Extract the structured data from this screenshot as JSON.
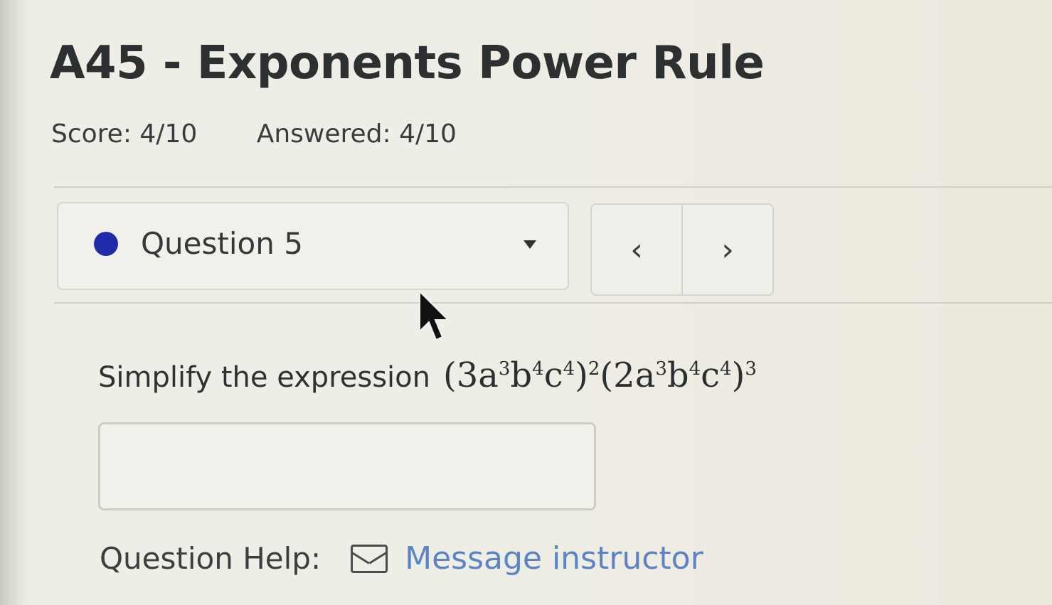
{
  "assignment": {
    "title": "A45 - Exponents Power Rule",
    "score": "Score: 4/10",
    "answered": "Answered: 4/10"
  },
  "question_nav": {
    "selected": "Question 5",
    "prev_label": "‹",
    "next_label": "›"
  },
  "question": {
    "prompt": "Simplify the expression",
    "expr": {
      "open1": "(3a",
      "a_exp1": "3",
      "b1": "b",
      "b_exp1": "4",
      "c1": "c",
      "c_exp1": "4",
      "close1": ")",
      "outer_exp1": "2",
      "open2": "(2a",
      "a_exp2": "3",
      "b2": "b",
      "b_exp2": "4",
      "c2": "c",
      "c_exp2": "4",
      "close2": ")",
      "outer_exp2": "3"
    },
    "answer_value": ""
  },
  "help": {
    "label": "Question Help:",
    "link": "Message instructor"
  },
  "colors": {
    "status_dot": "#1f2aa8",
    "link": "#5b84c4"
  }
}
